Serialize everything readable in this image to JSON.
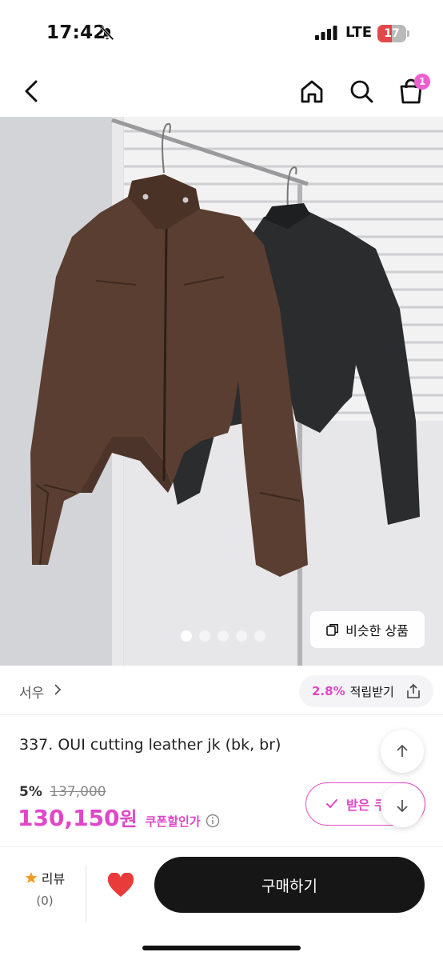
{
  "status_bar": {
    "time": "17:42",
    "network": "LTE",
    "battery": "17",
    "battery_level_percent": 17
  },
  "header": {
    "back_icon": "chevron-left-icon",
    "home_icon": "home-icon",
    "search_icon": "search-icon",
    "cart_icon": "shopping-bag-icon",
    "cart_badge": "1"
  },
  "gallery": {
    "image_count": 5,
    "active_index": 0,
    "similar_button": "비슷한 상품"
  },
  "seller": {
    "name": "서우",
    "points_rate": "2.8%",
    "points_label": "적립받기"
  },
  "product": {
    "name": "337. OUI cutting leather jk (bk, br)",
    "discount_pct": "5%",
    "original_price": "137,000",
    "price": "130,150",
    "price_unit": "원",
    "coupon_label": "쿠폰할인가",
    "coupon_button": "받은 쿠"
  },
  "bottom": {
    "review_label": "리뷰",
    "review_count": "(0)",
    "buy_button": "구매하기"
  },
  "colors": {
    "accent_pink": "#e145c8",
    "buy_button_bg": "#161616",
    "heart_red": "#ea3b3b",
    "star_orange": "#f59a23"
  }
}
